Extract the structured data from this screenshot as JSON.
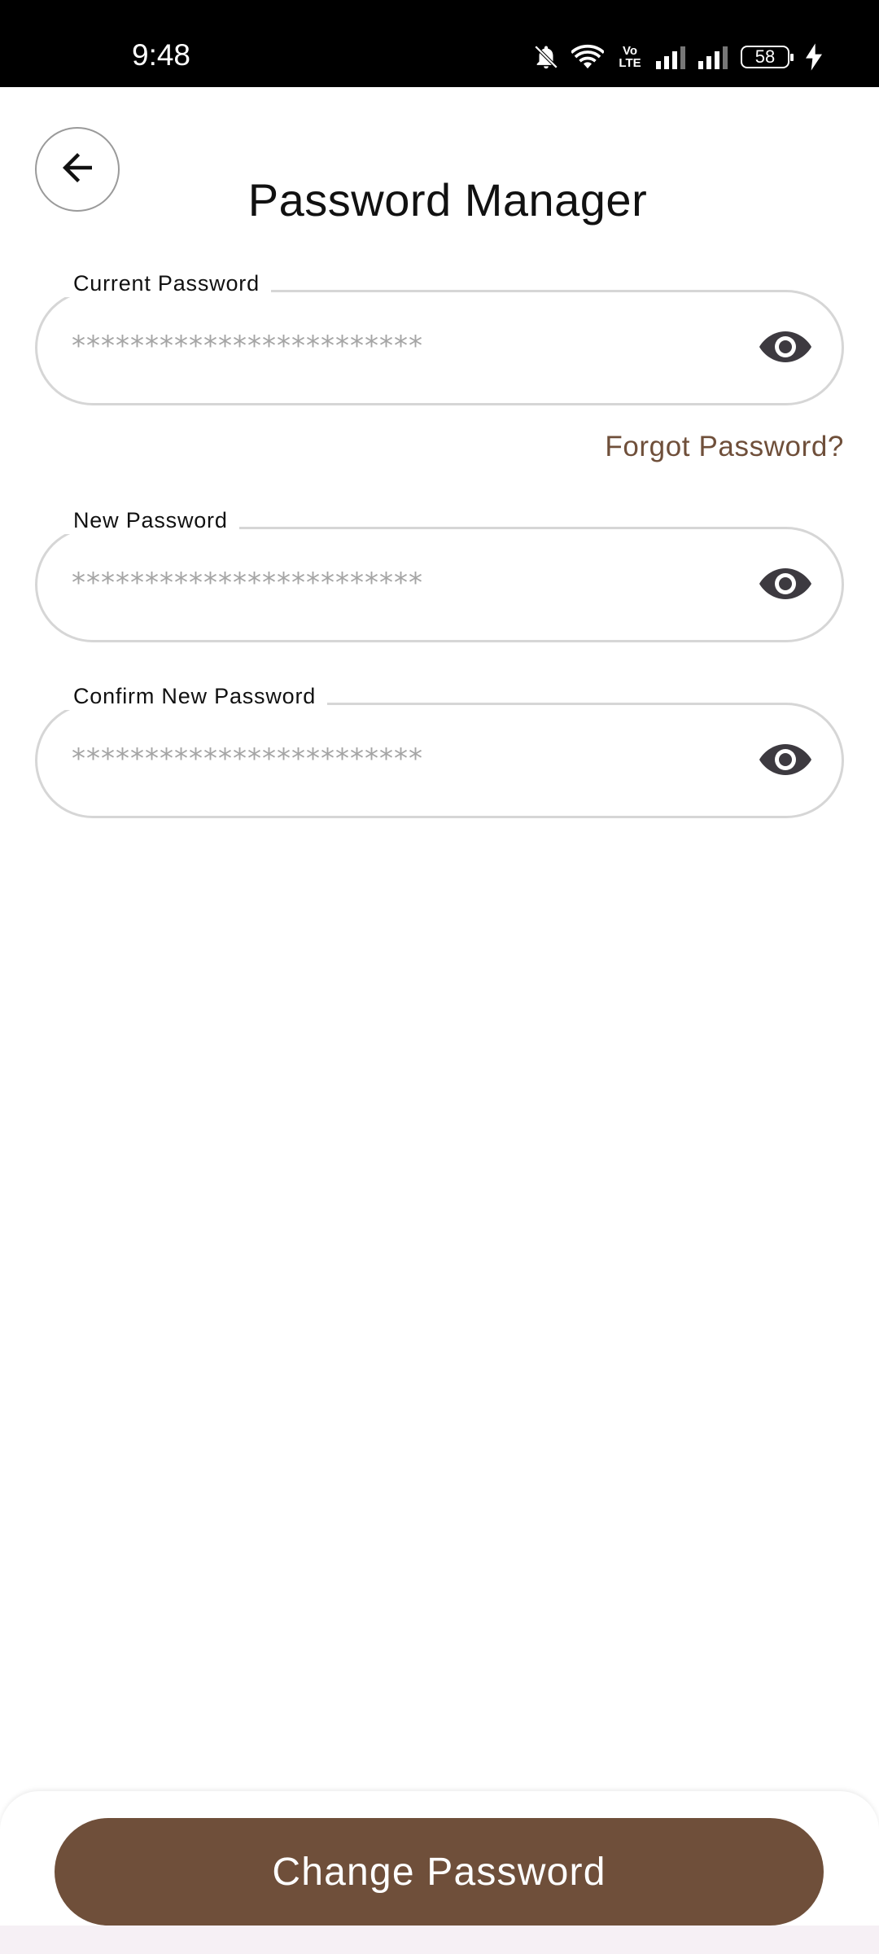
{
  "status_bar": {
    "time": "9:48",
    "battery_level": "58",
    "icons": [
      "bell-muted-icon",
      "wifi-icon",
      "volte-icon",
      "signal-icon",
      "signal-icon",
      "battery-icon",
      "charging-icon"
    ],
    "volte_label": "Vo LTE"
  },
  "header": {
    "title": "Password Manager",
    "back_icon": "arrow-left-icon"
  },
  "fields": [
    {
      "label": "Current Password",
      "value": "************************",
      "toggle_icon": "eye-icon"
    },
    {
      "label": "New Password",
      "value": "************************",
      "toggle_icon": "eye-icon"
    },
    {
      "label": "Confirm New Password",
      "value": "************************",
      "toggle_icon": "eye-icon"
    }
  ],
  "forgot_password": "Forgot Password?",
  "primary_action": "Change Password",
  "colors": {
    "accent": "#6f4f3a",
    "field_border": "#d6d6d6",
    "masked_text": "#a5a5a5",
    "eye_icon": "#3d3a40"
  }
}
